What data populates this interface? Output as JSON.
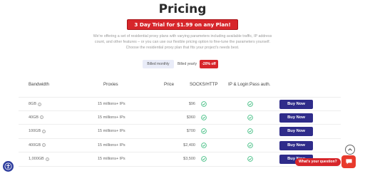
{
  "page": {
    "title": "Pricing",
    "trial_banner": "3 Day Trial for $1.99 on any Plan!",
    "intro": "We're offering a set of residential proxy plans with varying parameters including available traffic, IP address count, and other features – or you can use our flexible pricing option to fine-tune the parameters yourself. Choose the residential proxy plan that fits your project's needs best."
  },
  "billing": {
    "monthly_label": "Billed monthly",
    "yearly_label": "Billed yearly",
    "discount_label": "-20% off"
  },
  "table": {
    "headers": {
      "bandwidth": "Bandwidth",
      "proxies": "Proxies",
      "price": "Price",
      "socks": "SOCKS/HTTP",
      "ip_auth": "IP & Login:Pass auth."
    },
    "rows": [
      {
        "bandwidth": "8GB",
        "proxies": "15 millions+ IPs",
        "price": "$96",
        "socks": true,
        "ip_auth": true,
        "button": "Buy Now"
      },
      {
        "bandwidth": "40GB",
        "proxies": "15 millions+ IPs",
        "price": "$360",
        "socks": true,
        "ip_auth": true,
        "button": "Buy Now"
      },
      {
        "bandwidth": "100GB",
        "proxies": "15 millions+ IPs",
        "price": "$700",
        "socks": true,
        "ip_auth": true,
        "button": "Buy Now"
      },
      {
        "bandwidth": "400GB",
        "proxies": "15 millions+ IPs",
        "price": "$2,400",
        "socks": true,
        "ip_auth": true,
        "button": "Buy Now"
      },
      {
        "bandwidth": "1,000GB",
        "proxies": "15 millions+ IPs",
        "price": "$3,500",
        "socks": true,
        "ip_auth": true,
        "button": "Buy Now"
      }
    ]
  },
  "chat": {
    "prompt": "What's your question?"
  },
  "icons": {
    "check": "check-circle-icon",
    "info": "info-icon",
    "accessibility": "accessibility-icon",
    "scroll_top": "chevron-up-icon",
    "chat": "chat-bubble-icon"
  },
  "colors": {
    "accent_red": "#d7262b",
    "button_navy": "#2f2c8a",
    "check_green": "#2bb673"
  }
}
